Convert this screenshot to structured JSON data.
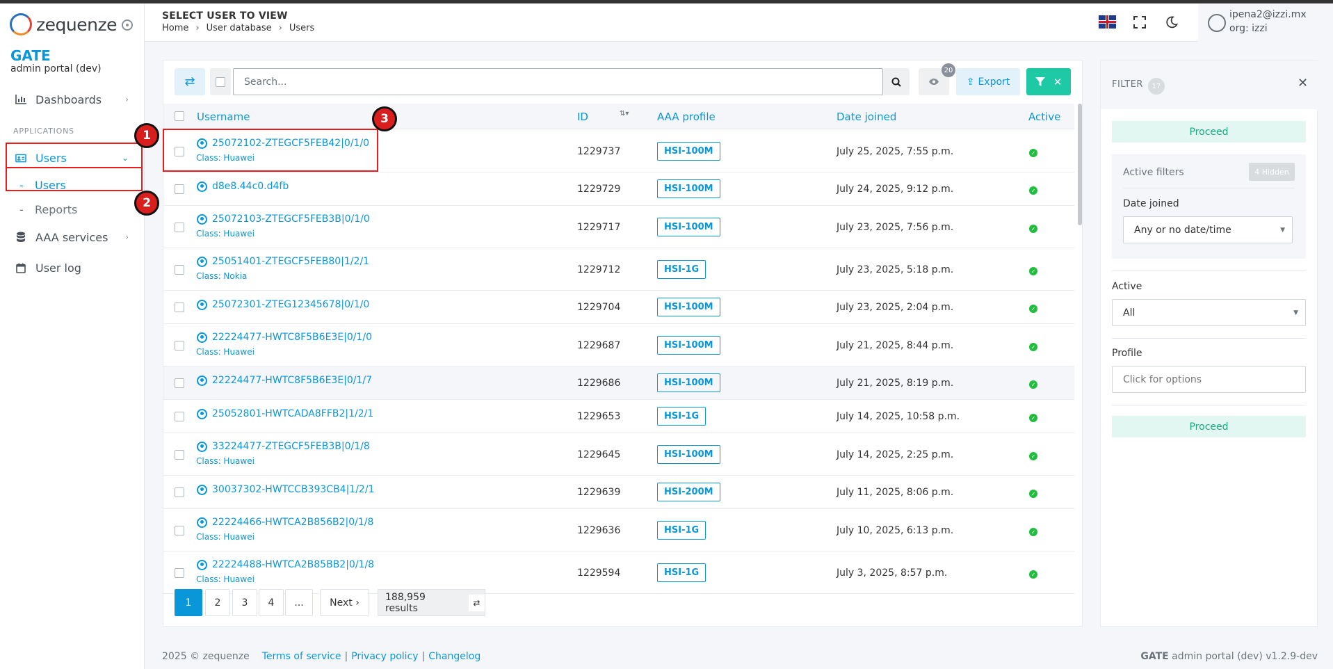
{
  "brand": {
    "logo_text": "zequenze",
    "app": "GATE",
    "subtitle": "admin portal (dev)"
  },
  "sidebar": {
    "section_label": "APPLICATIONS",
    "items": [
      {
        "label": "Dashboards"
      },
      {
        "label": "Users"
      },
      {
        "label": "AAA services"
      },
      {
        "label": "User log"
      }
    ],
    "sub_items": [
      {
        "label": "Users"
      },
      {
        "label": "Reports"
      }
    ]
  },
  "annotations": [
    "1",
    "2",
    "3"
  ],
  "header": {
    "title": "SELECT USER TO VIEW",
    "breadcrumb": [
      "Home",
      "User database",
      "Users"
    ],
    "user_email": "ipena2@izzi.mx",
    "user_org": "org: izzi"
  },
  "toolbar": {
    "search_placeholder": "Search...",
    "eye_count": "20",
    "export_label": "Export"
  },
  "table": {
    "columns": [
      "Username",
      "ID",
      "AAA profile",
      "Date joined",
      "Active"
    ],
    "rows": [
      {
        "username": "25072102-ZTEGCF5FEB42|0/1/0",
        "class": "Class: Huawei",
        "id": "1229737",
        "profile": "HSI-100M",
        "date": "July 25, 2025, 7:55 p.m."
      },
      {
        "username": "d8e8.44c0.d4fb",
        "class": "",
        "id": "1229729",
        "profile": "HSI-100M",
        "date": "July 24, 2025, 9:12 p.m."
      },
      {
        "username": "25072103-ZTEGCF5FEB3B|0/1/0",
        "class": "Class: Huawei",
        "id": "1229717",
        "profile": "HSI-100M",
        "date": "July 23, 2025, 7:56 p.m."
      },
      {
        "username": "25051401-ZTEGCF5FEB80|1/2/1",
        "class": "Class: Nokia",
        "id": "1229712",
        "profile": "HSI-1G",
        "date": "July 23, 2025, 5:18 p.m."
      },
      {
        "username": "25072301-ZTEG12345678|0/1/0",
        "class": "",
        "id": "1229704",
        "profile": "HSI-100M",
        "date": "July 23, 2025, 2:04 p.m."
      },
      {
        "username": "22224477-HWTC8F5B6E3E|0/1/0",
        "class": "Class: Huawei",
        "id": "1229687",
        "profile": "HSI-100M",
        "date": "July 21, 2025, 8:44 p.m."
      },
      {
        "username": "22224477-HWTC8F5B6E3E|0/1/7",
        "class": "",
        "id": "1229686",
        "profile": "HSI-100M",
        "date": "July 21, 2025, 8:19 p.m."
      },
      {
        "username": "25052801-HWTCADA8FFB2|1/2/1",
        "class": "",
        "id": "1229653",
        "profile": "HSI-1G",
        "date": "July 14, 2025, 10:58 p.m."
      },
      {
        "username": "33224477-ZTEGCF5FEB3B|0/1/8",
        "class": "Class: Huawei",
        "id": "1229645",
        "profile": "HSI-100M",
        "date": "July 14, 2025, 2:25 p.m."
      },
      {
        "username": "30037302-HWTCCB393CB4|1/2/1",
        "class": "",
        "id": "1229639",
        "profile": "HSI-200M",
        "date": "July 11, 2025, 8:06 p.m."
      },
      {
        "username": "22224466-HWTCA2B856B2|0/1/8",
        "class": "Class: Huawei",
        "id": "1229636",
        "profile": "HSI-1G",
        "date": "July 10, 2025, 6:13 p.m."
      },
      {
        "username": "22224488-HWTCA2B85BB2|0/1/8",
        "class": "Class: Huawei",
        "id": "1229594",
        "profile": "HSI-1G",
        "date": "July 3, 2025, 8:57 p.m."
      }
    ]
  },
  "pagination": {
    "pages": [
      "1",
      "2",
      "3",
      "4",
      "..."
    ],
    "next": "Next ›",
    "results": "188,959 results"
  },
  "filter": {
    "title": "FILTER",
    "count": "17",
    "proceed": "Proceed",
    "active_filters": "Active filters",
    "hidden": "4 Hidden",
    "date_label": "Date joined",
    "date_value": "Any or no date/time",
    "active_label": "Active",
    "active_value": "All",
    "profile_label": "Profile",
    "profile_placeholder": "Click for options"
  },
  "footer": {
    "copyright": "2025 © zequenze",
    "links": [
      "Terms of service",
      "Privacy policy",
      "Changelog"
    ],
    "app_name": "GATE",
    "version_text": "admin portal (dev) v1.2.9-dev"
  },
  "colors": {
    "accent": "#0a97d9",
    "success": "#1fbe3c",
    "teal": "#1ec9a5",
    "annotation": "#e81c1c"
  }
}
